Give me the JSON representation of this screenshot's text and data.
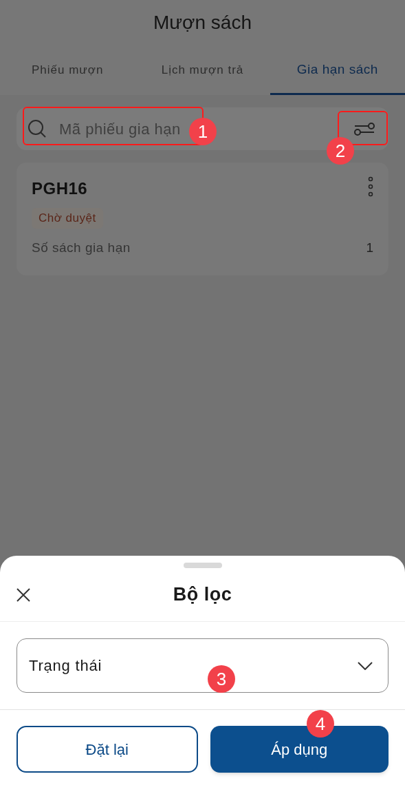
{
  "header": {
    "title": "Mượn sách"
  },
  "tabs": [
    {
      "label": "Phiếu mượn",
      "selected": false
    },
    {
      "label": "Lịch mượn trả",
      "selected": false
    },
    {
      "label": "Gia hạn sách",
      "selected": true
    }
  ],
  "search": {
    "placeholder": "Mã phiếu gia hạn"
  },
  "requests": [
    {
      "code": "PGH16",
      "status": "Chờ duyệt",
      "count_label": "Số sách gia hạn",
      "count": "1"
    }
  ],
  "filter_sheet": {
    "title": "Bộ lọc",
    "fields": [
      {
        "label": "Trạng thái"
      }
    ],
    "buttons": [
      {
        "label": "Đặt lại",
        "kind": "secondary"
      },
      {
        "label": "Áp dụng",
        "kind": "primary"
      }
    ]
  },
  "annotations": [
    {
      "number": "1"
    },
    {
      "number": "2"
    },
    {
      "number": "3"
    },
    {
      "number": "4"
    }
  ]
}
